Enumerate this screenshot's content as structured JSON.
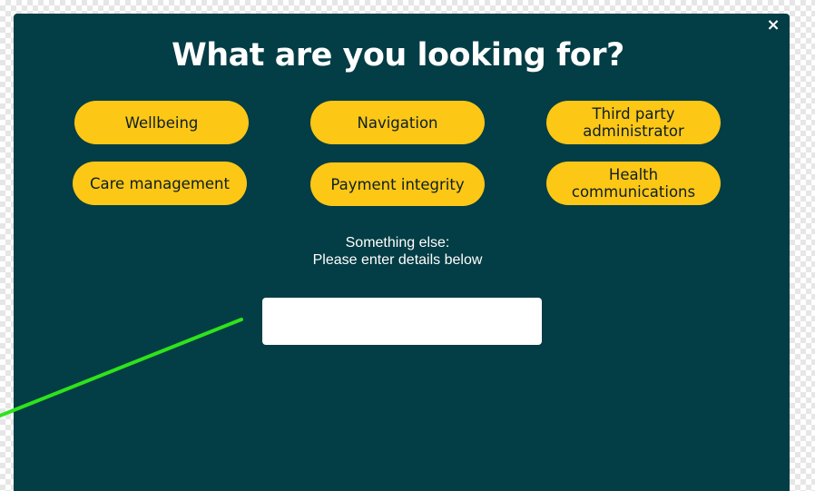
{
  "modal": {
    "title": "What are you looking for?",
    "close_label": "×"
  },
  "options": [
    {
      "label": "Wellbeing"
    },
    {
      "label": "Navigation"
    },
    {
      "label": "Third party administrator"
    },
    {
      "label": "Care management"
    },
    {
      "label": "Payment integrity"
    },
    {
      "label": "Health communications"
    }
  ],
  "other": {
    "line1": "Something else:",
    "line2": "Please enter details below",
    "input_value": "",
    "input_placeholder": ""
  },
  "colors": {
    "modal_background": "#033d45",
    "button_background": "#fdc716",
    "button_text": "#0d1f24",
    "annotation_line": "#2ee31a"
  }
}
